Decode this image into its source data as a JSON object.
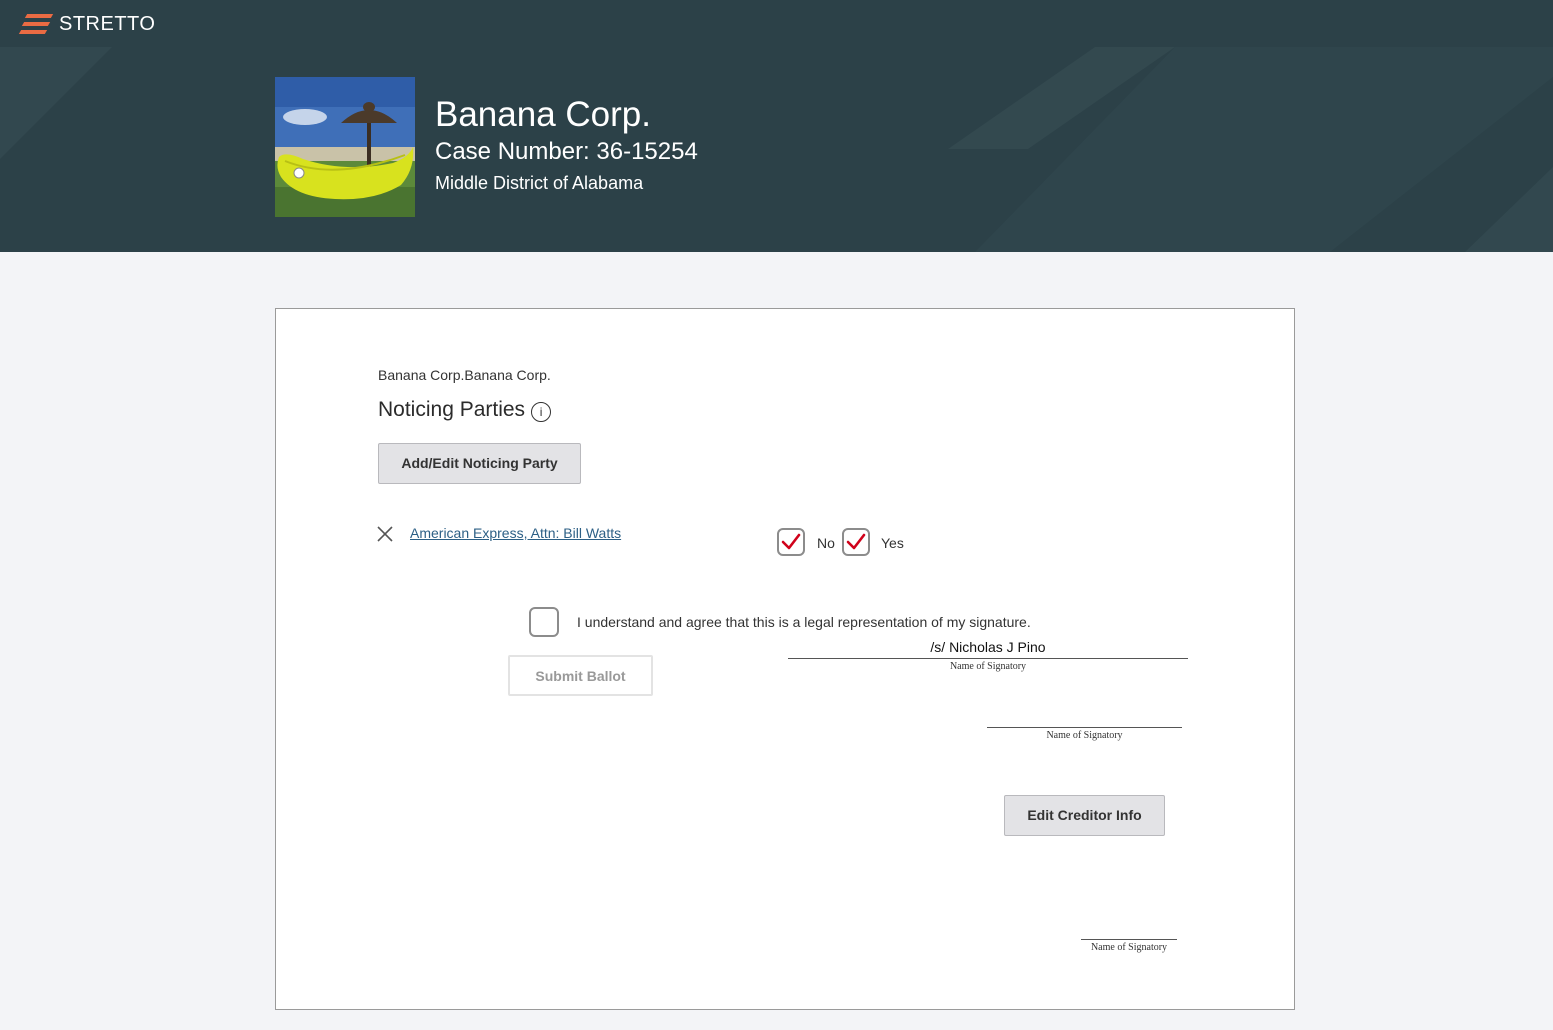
{
  "brand": {
    "name": "STRETTO",
    "accent_color": "#ea6b43",
    "header_bg": "#2c4148"
  },
  "case": {
    "title": "Banana Corp.",
    "case_number": "Case Number: 36-15254",
    "district": "Middle District of Alabama"
  },
  "form": {
    "subtitle": "Banana Corp.Banana Corp.",
    "section_title": "Noticing Parties",
    "info_icon": "i",
    "add_edit_button": "Add/Edit Noticing Party",
    "party": {
      "name": "American Express, Attn: Bill Watts",
      "remove_icon": "close-icon"
    },
    "options": {
      "no_label": "No",
      "no_checked": true,
      "yes_label": "Yes",
      "yes_checked": true,
      "check_color": "#d0021b"
    },
    "agreement": {
      "text": "I understand and agree that this is a legal representation of my signature.",
      "checked": false
    },
    "submit_button": "Submit Ballot",
    "signature": {
      "value": "/s/ Nicholas J Pino",
      "caption_1": "Name of Signatory",
      "caption_2": "Name of Signatory",
      "caption_3": "Name of Signatory"
    },
    "edit_creditor_button": "Edit Creditor Info"
  }
}
